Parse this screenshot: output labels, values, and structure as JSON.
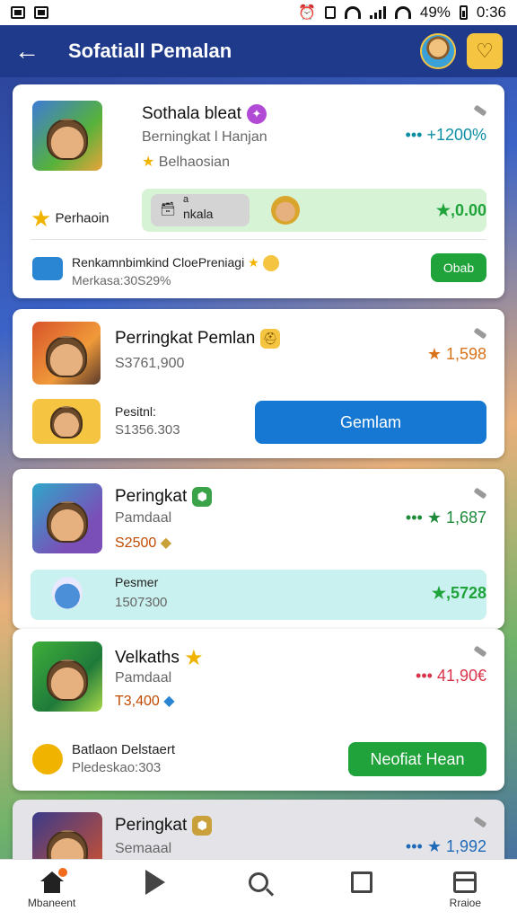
{
  "status": {
    "battery": "49%",
    "time": "0:36"
  },
  "appbar": {
    "title": "Sofatiall Pemalan"
  },
  "cards": [
    {
      "title": "Sothala bleat",
      "sub": "Berningkat l Hanjan",
      "tag": "Belhaosian",
      "stat": "••• +1200%",
      "left_label": "Perhaoin",
      "chip_label": "nkala",
      "chip_small": "a",
      "panel_value": "★,0.00",
      "promo_line1": "Renkamnbimkind CloePreniagi",
      "promo_line2": "Merkasa:30S29%",
      "promo_btn": "Obab"
    },
    {
      "title": "Perringkat Pemlan",
      "price": "S3761,900",
      "stat": "★ 1,598",
      "sub_label": "Pesitnl:",
      "sub_value": "S1356.303",
      "button": "Gemlam"
    },
    {
      "title": "Peringkat",
      "sub": "Pamdaal",
      "price": "S2500",
      "stat": "••• ★ 1,687",
      "panel_label": "Pesmer",
      "panel_value": "1507300",
      "panel_stat": "★,5728"
    },
    {
      "title": "Velkaths",
      "sub": "Pamdaal",
      "price": "T3,400",
      "stat": "••• 41,90€",
      "footer_title": "Batlaon Delstaert",
      "footer_value": "Pledeskao:303",
      "button": "Neofiat Hean"
    },
    {
      "title": "Peringkat",
      "sub": "Semaaal",
      "stat": "••• ★ 1,992"
    }
  ],
  "nav": [
    {
      "label": "Mbaneent"
    },
    {
      "label": ""
    },
    {
      "label": ""
    },
    {
      "label": ""
    },
    {
      "label": "Rraioe"
    }
  ],
  "colors": {
    "appbar": "#1f3a8a",
    "green": "#1fa33a",
    "blue_button": "#1678d2",
    "stat_teal": "#0c8ea3",
    "stat_orange": "#d9731a",
    "stat_red": "#d8334a"
  }
}
